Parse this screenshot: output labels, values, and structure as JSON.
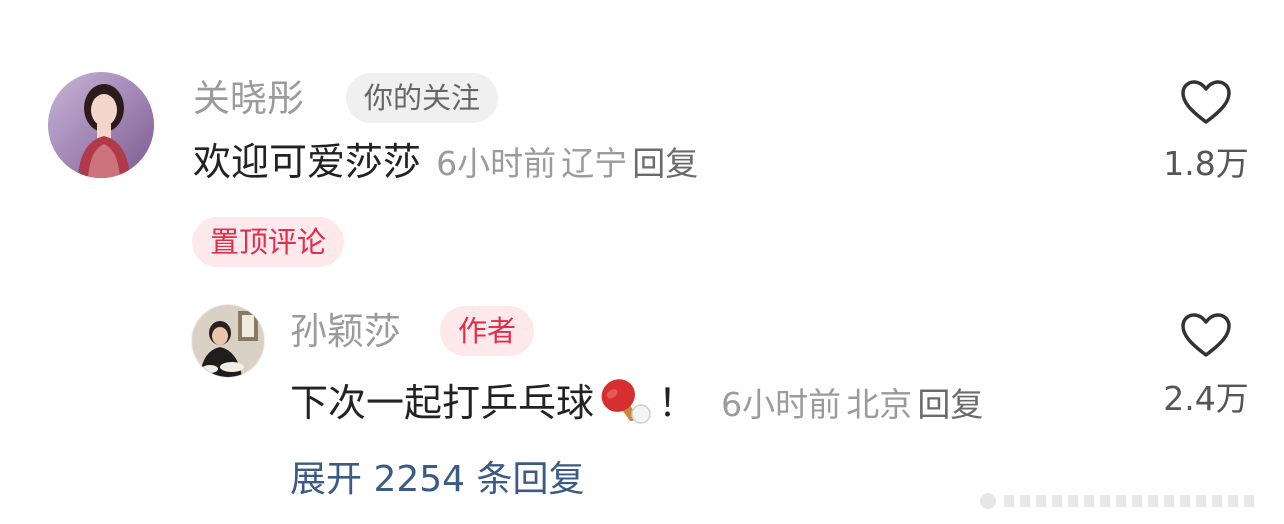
{
  "pinned_comment": {
    "author": "关晓彤",
    "badge": "你的关注",
    "text": "欢迎可爱莎莎",
    "time": "6小时前",
    "location": "辽宁",
    "reply_label": "回复",
    "likes": "1.8万",
    "pinned_label": "置顶评论"
  },
  "reply_comment": {
    "author": "孙颖莎",
    "badge": "作者",
    "text": "下次一起打乒乓球",
    "emoji": "ping-pong-icon",
    "suffix": "！",
    "time": "6小时前",
    "location": "北京",
    "reply_label": "回复",
    "likes": "2.4万"
  },
  "expand_replies": "展开 2254 条回复",
  "colors": {
    "pinned_badge_bg": "#fde9ec",
    "pinned_badge_text": "#e02e4d",
    "link_blue": "#3b5a86",
    "muted_gray": "#9b9b9b"
  },
  "icons": {
    "like": "heart-outline-icon",
    "emoji": "ping-pong-icon"
  }
}
